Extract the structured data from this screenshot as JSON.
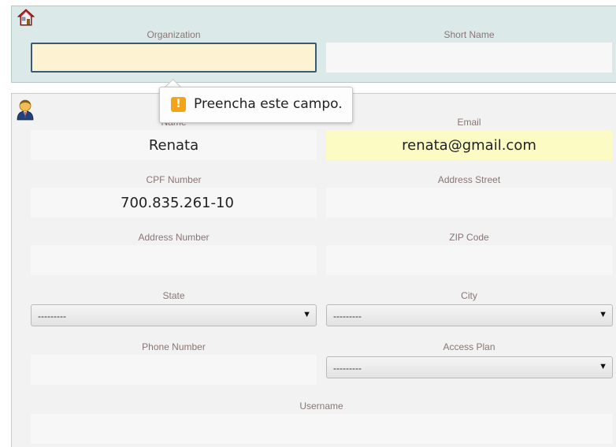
{
  "icons": {
    "organization": "home-icon",
    "user": "user-icon"
  },
  "organization": {
    "organization_label": "Organization",
    "organization_value": "",
    "short_name_label": "Short Name",
    "short_name_value": ""
  },
  "validation_tooltip": {
    "message": "Preencha este campo.",
    "icon": "warning-icon"
  },
  "user": {
    "name_label": "Name",
    "name_value": "Renata",
    "email_label": "Email",
    "email_value": "renata@gmail.com",
    "cpf_label": "CPF Number",
    "cpf_value": "700.835.261-10",
    "address_street_label": "Address Street",
    "address_street_value": "",
    "address_number_label": "Address Number",
    "address_number_value": "",
    "zip_label": "ZIP Code",
    "zip_value": "",
    "state_label": "State",
    "state_value": "---------",
    "city_label": "City",
    "city_value": "---------",
    "phone_label": "Phone Number",
    "phone_value": "",
    "access_plan_label": "Access Plan",
    "access_plan_value": "---------",
    "username_label": "Username",
    "username_value": ""
  },
  "colors": {
    "org_panel_bg": "#dbeae8",
    "focus_border": "#3d5a75",
    "focus_bg": "#fcf3d3",
    "autofill_bg": "#fbfbc3",
    "label_text": "#8a7575",
    "warning": "#f2a51a"
  }
}
